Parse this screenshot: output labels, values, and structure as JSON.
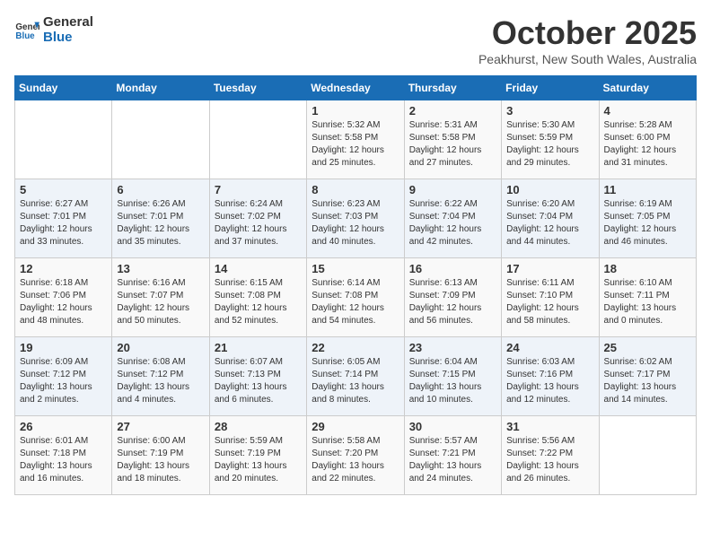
{
  "logo": {
    "line1": "General",
    "line2": "Blue"
  },
  "title": "October 2025",
  "subtitle": "Peakhurst, New South Wales, Australia",
  "days_of_week": [
    "Sunday",
    "Monday",
    "Tuesday",
    "Wednesday",
    "Thursday",
    "Friday",
    "Saturday"
  ],
  "weeks": [
    [
      {
        "day": "",
        "content": ""
      },
      {
        "day": "",
        "content": ""
      },
      {
        "day": "",
        "content": ""
      },
      {
        "day": "1",
        "content": "Sunrise: 5:32 AM\nSunset: 5:58 PM\nDaylight: 12 hours\nand 25 minutes."
      },
      {
        "day": "2",
        "content": "Sunrise: 5:31 AM\nSunset: 5:58 PM\nDaylight: 12 hours\nand 27 minutes."
      },
      {
        "day": "3",
        "content": "Sunrise: 5:30 AM\nSunset: 5:59 PM\nDaylight: 12 hours\nand 29 minutes."
      },
      {
        "day": "4",
        "content": "Sunrise: 5:28 AM\nSunset: 6:00 PM\nDaylight: 12 hours\nand 31 minutes."
      }
    ],
    [
      {
        "day": "5",
        "content": "Sunrise: 6:27 AM\nSunset: 7:01 PM\nDaylight: 12 hours\nand 33 minutes."
      },
      {
        "day": "6",
        "content": "Sunrise: 6:26 AM\nSunset: 7:01 PM\nDaylight: 12 hours\nand 35 minutes."
      },
      {
        "day": "7",
        "content": "Sunrise: 6:24 AM\nSunset: 7:02 PM\nDaylight: 12 hours\nand 37 minutes."
      },
      {
        "day": "8",
        "content": "Sunrise: 6:23 AM\nSunset: 7:03 PM\nDaylight: 12 hours\nand 40 minutes."
      },
      {
        "day": "9",
        "content": "Sunrise: 6:22 AM\nSunset: 7:04 PM\nDaylight: 12 hours\nand 42 minutes."
      },
      {
        "day": "10",
        "content": "Sunrise: 6:20 AM\nSunset: 7:04 PM\nDaylight: 12 hours\nand 44 minutes."
      },
      {
        "day": "11",
        "content": "Sunrise: 6:19 AM\nSunset: 7:05 PM\nDaylight: 12 hours\nand 46 minutes."
      }
    ],
    [
      {
        "day": "12",
        "content": "Sunrise: 6:18 AM\nSunset: 7:06 PM\nDaylight: 12 hours\nand 48 minutes."
      },
      {
        "day": "13",
        "content": "Sunrise: 6:16 AM\nSunset: 7:07 PM\nDaylight: 12 hours\nand 50 minutes."
      },
      {
        "day": "14",
        "content": "Sunrise: 6:15 AM\nSunset: 7:08 PM\nDaylight: 12 hours\nand 52 minutes."
      },
      {
        "day": "15",
        "content": "Sunrise: 6:14 AM\nSunset: 7:08 PM\nDaylight: 12 hours\nand 54 minutes."
      },
      {
        "day": "16",
        "content": "Sunrise: 6:13 AM\nSunset: 7:09 PM\nDaylight: 12 hours\nand 56 minutes."
      },
      {
        "day": "17",
        "content": "Sunrise: 6:11 AM\nSunset: 7:10 PM\nDaylight: 12 hours\nand 58 minutes."
      },
      {
        "day": "18",
        "content": "Sunrise: 6:10 AM\nSunset: 7:11 PM\nDaylight: 13 hours\nand 0 minutes."
      }
    ],
    [
      {
        "day": "19",
        "content": "Sunrise: 6:09 AM\nSunset: 7:12 PM\nDaylight: 13 hours\nand 2 minutes."
      },
      {
        "day": "20",
        "content": "Sunrise: 6:08 AM\nSunset: 7:12 PM\nDaylight: 13 hours\nand 4 minutes."
      },
      {
        "day": "21",
        "content": "Sunrise: 6:07 AM\nSunset: 7:13 PM\nDaylight: 13 hours\nand 6 minutes."
      },
      {
        "day": "22",
        "content": "Sunrise: 6:05 AM\nSunset: 7:14 PM\nDaylight: 13 hours\nand 8 minutes."
      },
      {
        "day": "23",
        "content": "Sunrise: 6:04 AM\nSunset: 7:15 PM\nDaylight: 13 hours\nand 10 minutes."
      },
      {
        "day": "24",
        "content": "Sunrise: 6:03 AM\nSunset: 7:16 PM\nDaylight: 13 hours\nand 12 minutes."
      },
      {
        "day": "25",
        "content": "Sunrise: 6:02 AM\nSunset: 7:17 PM\nDaylight: 13 hours\nand 14 minutes."
      }
    ],
    [
      {
        "day": "26",
        "content": "Sunrise: 6:01 AM\nSunset: 7:18 PM\nDaylight: 13 hours\nand 16 minutes."
      },
      {
        "day": "27",
        "content": "Sunrise: 6:00 AM\nSunset: 7:19 PM\nDaylight: 13 hours\nand 18 minutes."
      },
      {
        "day": "28",
        "content": "Sunrise: 5:59 AM\nSunset: 7:19 PM\nDaylight: 13 hours\nand 20 minutes."
      },
      {
        "day": "29",
        "content": "Sunrise: 5:58 AM\nSunset: 7:20 PM\nDaylight: 13 hours\nand 22 minutes."
      },
      {
        "day": "30",
        "content": "Sunrise: 5:57 AM\nSunset: 7:21 PM\nDaylight: 13 hours\nand 24 minutes."
      },
      {
        "day": "31",
        "content": "Sunrise: 5:56 AM\nSunset: 7:22 PM\nDaylight: 13 hours\nand 26 minutes."
      },
      {
        "day": "",
        "content": ""
      }
    ]
  ]
}
